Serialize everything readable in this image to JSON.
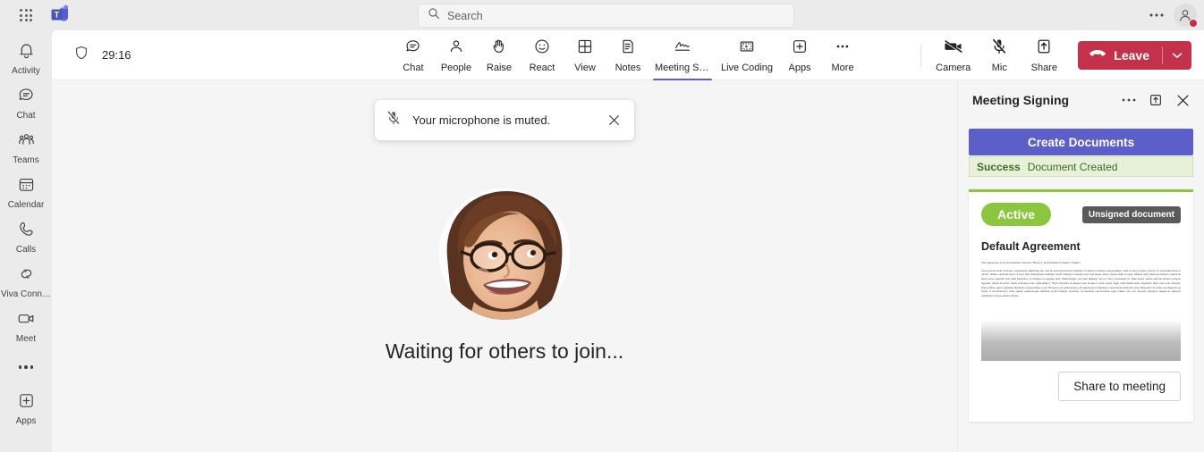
{
  "titlebar": {
    "app_launcher": "app-launcher",
    "brand": "Microsoft Teams",
    "search": {
      "placeholder": "Search",
      "value": ""
    },
    "more_label": "…",
    "avatar_presence_color": "#c4314b"
  },
  "rail": {
    "items": [
      {
        "label": "Activity",
        "icon": "bell-icon"
      },
      {
        "label": "Chat",
        "icon": "chat-icon"
      },
      {
        "label": "Teams",
        "icon": "teams-icon"
      },
      {
        "label": "Calendar",
        "icon": "calendar-icon"
      },
      {
        "label": "Calls",
        "icon": "phone-icon"
      },
      {
        "label": "Viva Conne…",
        "icon": "viva-connections-icon"
      },
      {
        "label": "Meet",
        "icon": "video-icon"
      }
    ],
    "more_label": "more-apps",
    "apps": {
      "label": "Apps",
      "icon": "plus-box-icon"
    }
  },
  "meeting_toolbar": {
    "shield_icon": "shield-icon",
    "timer": "29:16",
    "tools": [
      {
        "label": "Chat",
        "icon": "chat-icon",
        "active": false
      },
      {
        "label": "People",
        "icon": "person-icon",
        "active": false
      },
      {
        "label": "Raise",
        "icon": "hand-icon",
        "active": false
      },
      {
        "label": "React",
        "icon": "smiley-icon",
        "active": false
      },
      {
        "label": "View",
        "icon": "grid-icon",
        "active": false
      },
      {
        "label": "Notes",
        "icon": "notes-icon",
        "active": false
      },
      {
        "label": "Meeting Sig…",
        "icon": "signature-icon",
        "active": true
      },
      {
        "label": "Live Coding",
        "icon": "live-coding-icon",
        "active": false
      },
      {
        "label": "Apps",
        "icon": "plus-box-icon",
        "active": false
      },
      {
        "label": "More",
        "icon": "ellipsis-icon",
        "active": false
      }
    ],
    "controls": [
      {
        "label": "Camera",
        "icon": "camera-off-icon",
        "state": "off"
      },
      {
        "label": "Mic",
        "icon": "mic-off-icon",
        "state": "muted"
      },
      {
        "label": "Share",
        "icon": "share-icon",
        "state": "idle"
      }
    ],
    "leave": {
      "label": "Leave",
      "color": "#c4314b",
      "icon": "hangup-icon",
      "caret_icon": "chevron-down-icon"
    },
    "active_accent": "#5b5fc7"
  },
  "toast": {
    "icon": "mic-off-icon",
    "message": "Your microphone is muted.",
    "close_icon": "close-icon"
  },
  "stage": {
    "avatar_name": "participant-avatar",
    "status_text": "Waiting for others to join..."
  },
  "panel": {
    "title": "Meeting Signing",
    "more_icon": "ellipsis-icon",
    "popout_icon": "pop-out-icon",
    "close_icon": "close-icon",
    "create_button": "Create Documents",
    "status": {
      "label": "Success",
      "message": "Document Created",
      "color": "#3c6e21",
      "bg": "#e7f0d9"
    },
    "document": {
      "state_pill": "Active",
      "state_pill_color": "#8cc63f",
      "signature_badge": "Unsigned document",
      "signature_badge_color": "#5a5a5a",
      "title": "Default Agreement",
      "preview_paragraphs": [
        "This agreement is by and between Contoso (\"Buyer\"), and Northwind Traders (\"Seller\").",
        "Lorem ipsum dolor sit amet, consectetur adipiscing elit, sed do eiusmod tempor incididunt ut labore et dolore magna aliqua. Velit ut tortor pretium viverra. Ut venenatis tellus in metus. Nullam vehicula ipsum a arcu. Elit pellentesque habitant morbi tristique in iaculis nunc sed augue lacus viverra vitae congue. Aliquet nibh praesent tristique magna sit amet purus gravida. Arcu felis bibendum ut tristique et egestas quis. Pellentesque nec nam aliquam sem et tortor consequat id. Vitae turpis massa sed elementum tempus egestas. Varius sit amet mattis vulputate enim nulla aliquet. Turpis tincidunt id aliquet risus feugiat in ante metus. Eget nulla facilisi etiam dignissim diam quis enim lobortis. Nisi porttitor quam vulputate dignissim suspendisse in est. Rhoncus est pellentesque elit ullamcorper dignissim cras tincidunt lobortis. Arcu bibendum at varius vel pharetra vel turpis. A condimentum vitae sapien pellentesque habitant morbi tristique senectus. Id faucibus nisl tincidunt eget nullam non nisi. Aenean pharetra magna ac placerat vestibulum lectus mauris ultrices."
      ],
      "share_button": "Share to meeting"
    }
  }
}
